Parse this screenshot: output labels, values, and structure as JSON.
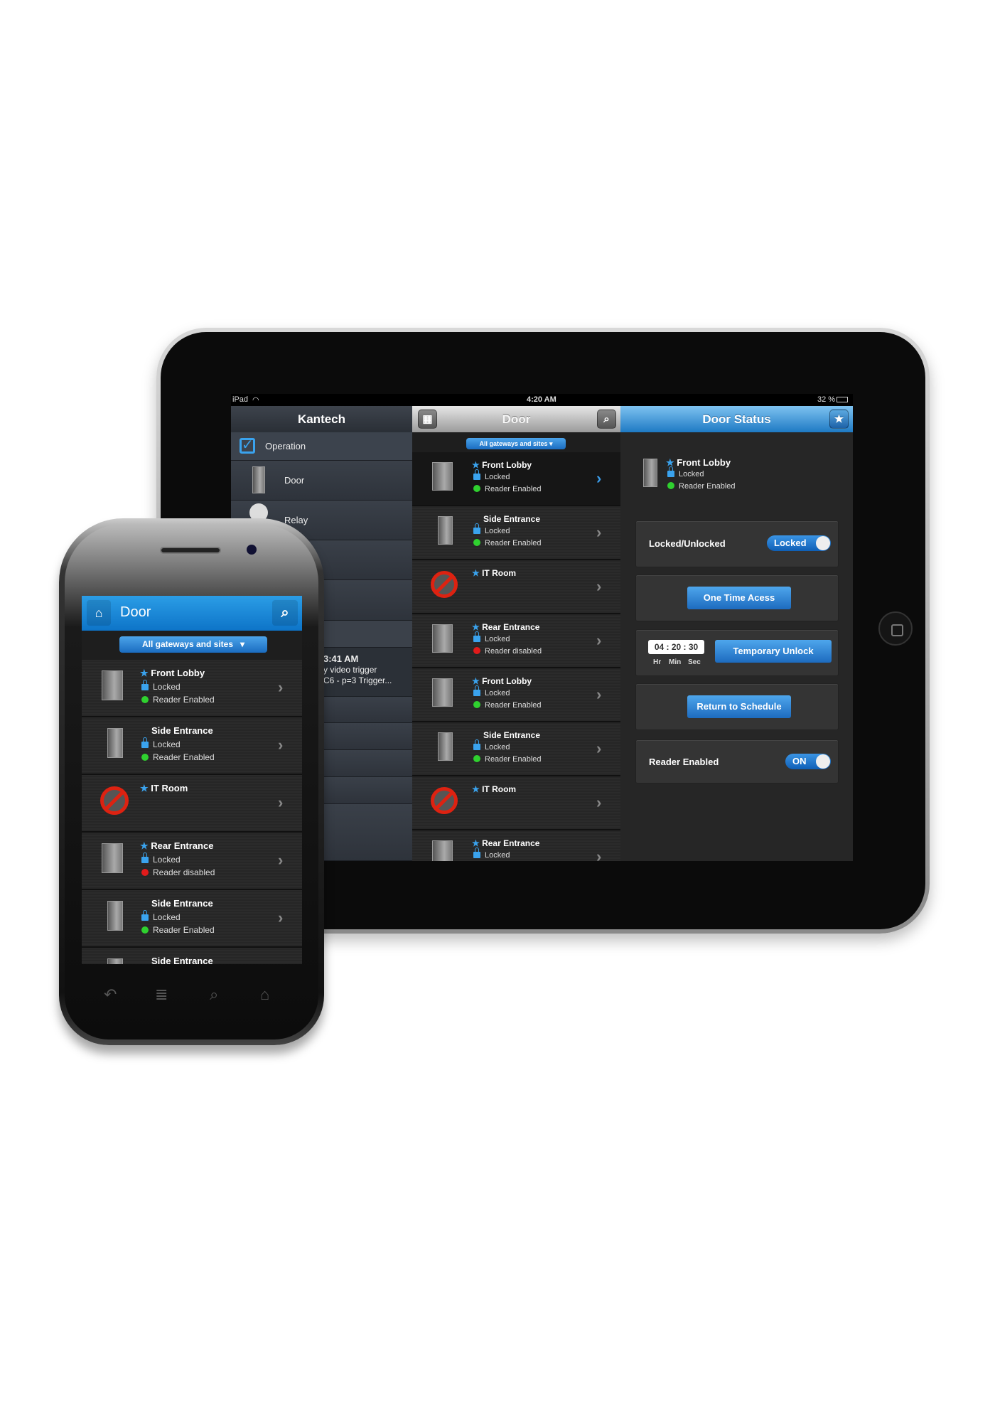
{
  "colors": {
    "accent": "#1e7ac4",
    "enabled": "#2fd12f",
    "disabled": "#e21b1b",
    "star": "#3aa3ee"
  },
  "ipad": {
    "status": {
      "device": "iPad",
      "time": "4:20 AM",
      "battery": "32 %",
      "wifi_icon": "wifi-icon",
      "battery_icon": "battery-icon"
    },
    "left": {
      "title": "Kantech",
      "operation": "Operation",
      "items": [
        "Door",
        "Relay"
      ],
      "event": {
        "time": "3:41 AM",
        "line1": "y video trigger",
        "line2": "C6 - p=3 Trigger..."
      }
    },
    "middle": {
      "title": "Door",
      "filter": "All gateways and sites",
      "rows": [
        {
          "name": "Front Lobby",
          "fav": true,
          "icon": "open",
          "lock": "Locked",
          "reader": "Reader Enabled",
          "ok": true,
          "active": true
        },
        {
          "name": "Side Entrance",
          "fav": false,
          "icon": "closed",
          "lock": "Locked",
          "reader": "Reader Enabled",
          "ok": true
        },
        {
          "name": "IT Room",
          "fav": true,
          "icon": "offline"
        },
        {
          "name": "Rear Entrance",
          "fav": true,
          "icon": "open",
          "lock": "Locked",
          "reader": "Reader disabled",
          "ok": false
        },
        {
          "name": "Front Lobby",
          "fav": true,
          "icon": "open",
          "lock": "Locked",
          "reader": "Reader Enabled",
          "ok": true
        },
        {
          "name": "Side Entrance",
          "fav": false,
          "icon": "closed",
          "lock": "Locked",
          "reader": "Reader Enabled",
          "ok": true
        },
        {
          "name": "IT Room",
          "fav": true,
          "icon": "offline"
        },
        {
          "name": "Rear Entrance",
          "fav": true,
          "icon": "open",
          "lock": "Locked",
          "reader": "",
          "ok": false
        }
      ]
    },
    "right": {
      "title": "Door Status",
      "door": {
        "name": "Front Lobby",
        "lock": "Locked",
        "reader": "Reader Enabled"
      },
      "locked_label": "Locked/Unlocked",
      "locked_toggle": "Locked",
      "one_time": "One Time Acess",
      "timer": "04 : 20 : 30",
      "hr": "Hr",
      "min": "Min",
      "sec": "Sec",
      "temp_unlock": "Temporary Unlock",
      "return_schedule": "Return to Schedule",
      "reader_label": "Reader Enabled",
      "reader_toggle": "ON"
    }
  },
  "phone": {
    "title": "Door",
    "filter": "All gateways and sites",
    "rows": [
      {
        "name": "Front Lobby",
        "fav": true,
        "icon": "open",
        "lock": "Locked",
        "reader": "Reader Enabled",
        "ok": true
      },
      {
        "name": "Side Entrance",
        "fav": false,
        "icon": "closed",
        "lock": "Locked",
        "reader": "Reader Enabled",
        "ok": true
      },
      {
        "name": "IT Room",
        "fav": true,
        "icon": "offline"
      },
      {
        "name": "Rear Entrance",
        "fav": true,
        "icon": "open",
        "lock": "Locked",
        "reader": "Reader disabled",
        "ok": false
      },
      {
        "name": "Side Entrance",
        "fav": false,
        "icon": "closed",
        "lock": "Locked",
        "reader": "Reader Enabled",
        "ok": true
      },
      {
        "name": "Side Entrance",
        "fav": false,
        "icon": "closed",
        "lock": "",
        "reader": "",
        "ok": true
      }
    ],
    "nav_icons": [
      "back-icon",
      "menu-icon",
      "search-icon",
      "home-icon"
    ]
  }
}
